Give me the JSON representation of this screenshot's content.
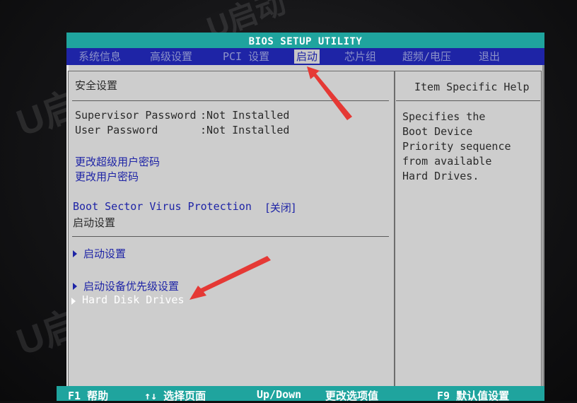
{
  "window": {
    "title": "BIOS SETUP UTILITY"
  },
  "menu": {
    "items": [
      {
        "label": "系统信息",
        "active": false
      },
      {
        "label": "高级设置",
        "active": false
      },
      {
        "label": "PCI 设置",
        "active": false
      },
      {
        "label": "启动",
        "active": true
      },
      {
        "label": "芯片组",
        "active": false
      },
      {
        "label": "超频/电压",
        "active": false
      },
      {
        "label": "退出",
        "active": false
      }
    ]
  },
  "main": {
    "section_title": "安全设置",
    "supervisor_password": {
      "label": "Supervisor Password",
      "value": ":Not Installed"
    },
    "user_password": {
      "label": "User Password",
      "value": ":Not Installed"
    },
    "change_supervisor_password": "更改超级用户密码",
    "change_user_password": "更改用户密码",
    "boot_sector_virus_protection": {
      "label": "Boot Sector Virus Protection",
      "value": "[关闭]"
    },
    "boot_settings_heading": "启动设置",
    "submenus": [
      {
        "label": "启动设置"
      },
      {
        "label": "启动设备优先级设置"
      },
      {
        "label": "Hard Disk Drives"
      }
    ]
  },
  "help": {
    "title": "Item Specific Help",
    "lines": [
      "Specifies the",
      "Boot Device",
      "Priority sequence",
      "from available",
      "Hard Drives."
    ]
  },
  "bottombar": {
    "items": [
      {
        "label": "F1  帮助"
      },
      {
        "label": "↑↓ 选择页面"
      },
      {
        "label": "Up/Down"
      },
      {
        "label": "更改选项值"
      },
      {
        "label": "F9  默认值设置"
      }
    ]
  },
  "colors": {
    "bios_blue": "#1e24a6",
    "bios_teal": "#1fa49e",
    "panel_gray": "#cdcdcd",
    "annotation_red": "#e53935"
  }
}
